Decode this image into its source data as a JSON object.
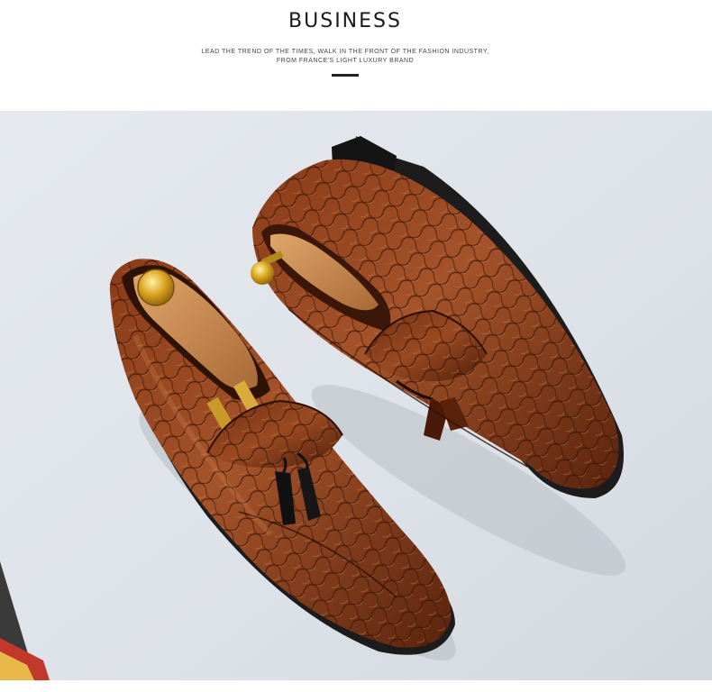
{
  "header": {
    "title": "BUSINESS",
    "subtitle_line1": "LEAD THE TREND OF THE TIMES, WALK IN THE FRONT OF THE FASHION INDUSTRY,",
    "subtitle_line2": "FROM FRANCE'S LIGHT LUXURY BRAND"
  },
  "photo": {
    "subject": "pair of brown crocodile-embossed tassel loafers with wooden shoe trees",
    "colors": {
      "background": "#dfe4ea",
      "leather": "#7a3414",
      "leather_light": "#a9552a",
      "sole": "#1c1c1c",
      "wood": "#c98d55",
      "brass": "#d9a520"
    }
  }
}
